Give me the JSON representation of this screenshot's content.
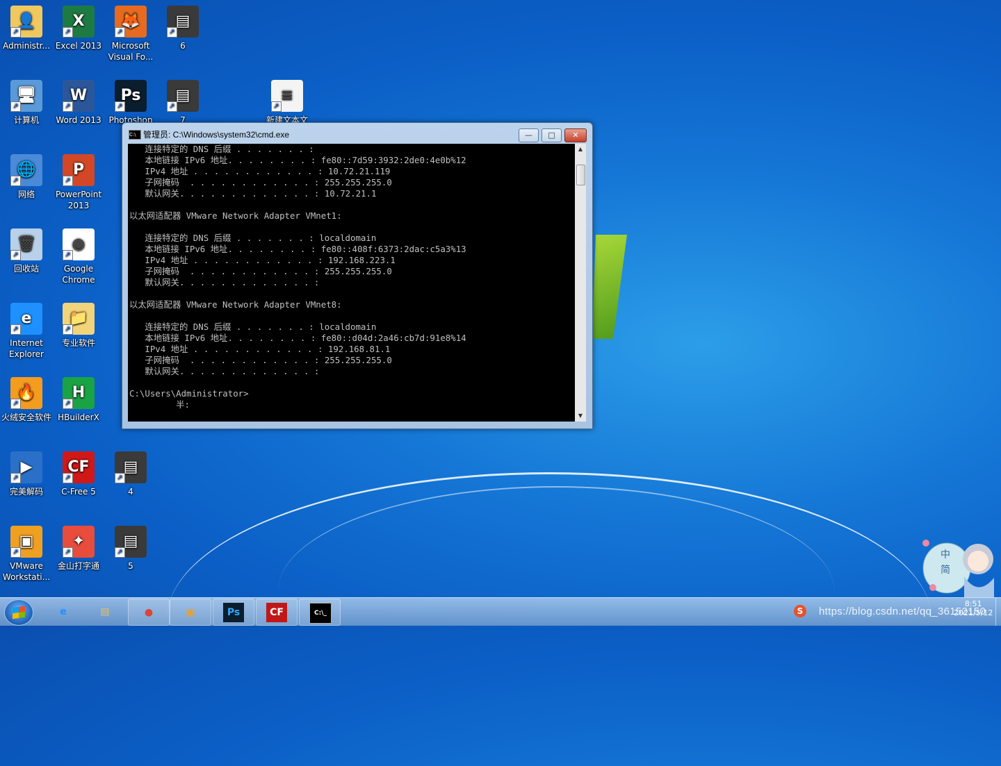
{
  "desktop": {
    "icons": [
      {
        "label": "Administr...",
        "icon": "user-folder-icon"
      },
      {
        "label": "Excel 2013",
        "icon": "excel-icon"
      },
      {
        "label": "Microsoft Visual Fo...",
        "icon": "foxpro-icon"
      },
      {
        "label": "6",
        "icon": "screenshot-thumbnail-icon"
      },
      {
        "label": "计算机",
        "icon": "computer-icon"
      },
      {
        "label": "Word 2013",
        "icon": "word-icon"
      },
      {
        "label": "Photoshop CC",
        "icon": "photoshop-icon"
      },
      {
        "label": "7",
        "icon": "screenshot-thumbnail-icon"
      },
      {
        "label": "新建文本文",
        "icon": "text-file-icon"
      },
      {
        "label": "网络",
        "icon": "network-icon"
      },
      {
        "label": "PowerPoint 2013",
        "icon": "powerpoint-icon"
      },
      {
        "label": "回收站",
        "icon": "recycle-bin-icon"
      },
      {
        "label": "Google Chrome",
        "icon": "chrome-icon"
      },
      {
        "label": "Internet Explorer",
        "icon": "ie-icon"
      },
      {
        "label": "专业软件",
        "icon": "folder-icon"
      },
      {
        "label": "火绒安全软件",
        "icon": "huorong-icon"
      },
      {
        "label": "HBuilderX",
        "icon": "hbuilder-icon"
      },
      {
        "label": "完美解码",
        "icon": "player-icon"
      },
      {
        "label": "C-Free 5",
        "icon": "cfree-icon"
      },
      {
        "label": "4",
        "icon": "screenshot-thumbnail-icon"
      },
      {
        "label": "VMware Workstati...",
        "icon": "vmware-icon"
      },
      {
        "label": "金山打字通",
        "icon": "typing-icon"
      },
      {
        "label": "5",
        "icon": "screenshot-thumbnail-icon"
      }
    ]
  },
  "cmd": {
    "title": "管理员: C:\\Windows\\system32\\cmd.exe",
    "minimize_label": "—",
    "maximize_label": "□",
    "close_label": "✕",
    "lines": [
      "   连接特定的 DNS 后缀 . . . . . . . :",
      "   本地链接 IPv6 地址. . . . . . . . : fe80::7d59:3932:2de0:4e0b%12",
      "   IPv4 地址 . . . . . . . . . . . . : 10.72.21.119",
      "   子网掩码  . . . . . . . . . . . . : 255.255.255.0",
      "   默认网关. . . . . . . . . . . . . : 10.72.21.1",
      "",
      "以太网适配器 VMware Network Adapter VMnet1:",
      "",
      "   连接特定的 DNS 后缀 . . . . . . . : localdomain",
      "   本地链接 IPv6 地址. . . . . . . . : fe80::408f:6373:2dac:c5a3%13",
      "   IPv4 地址 . . . . . . . . . . . . : 192.168.223.1",
      "   子网掩码  . . . . . . . . . . . . : 255.255.255.0",
      "   默认网关. . . . . . . . . . . . . :",
      "",
      "以太网适配器 VMware Network Adapter VMnet8:",
      "",
      "   连接特定的 DNS 后缀 . . . . . . . : localdomain",
      "   本地链接 IPv6 地址. . . . . . . . : fe80::d04d:2a46:cb7d:91e8%14",
      "   IPv4 地址 . . . . . . . . . . . . : 192.168.81.1",
      "   子网掩码  . . . . . . . . . . . . : 255.255.255.0",
      "   默认网关. . . . . . . . . . . . . :",
      "",
      "C:\\Users\\Administrator>",
      "         半:"
    ]
  },
  "taskbar": {
    "items": [
      {
        "name": "ie",
        "glyph": "e",
        "color": "#1e90ff"
      },
      {
        "name": "explorer",
        "glyph": "▤",
        "color": "#e8c060"
      },
      {
        "name": "chrome",
        "glyph": "●",
        "color": "#db4437"
      },
      {
        "name": "vmware",
        "glyph": "▣",
        "color": "#f0a020"
      },
      {
        "name": "photoshop",
        "glyph": "Ps",
        "color": "#31a8ff"
      },
      {
        "name": "cfree",
        "glyph": "CF",
        "color": "#ffffff"
      },
      {
        "name": "cmd",
        "glyph": "C:\\_",
        "color": "#ffffff"
      }
    ],
    "watermark": "https://blog.csdn.net/qq_36152150",
    "time": "8:51",
    "date": "2021/5/12",
    "ime_top": "中",
    "ime_bottom": "简"
  }
}
